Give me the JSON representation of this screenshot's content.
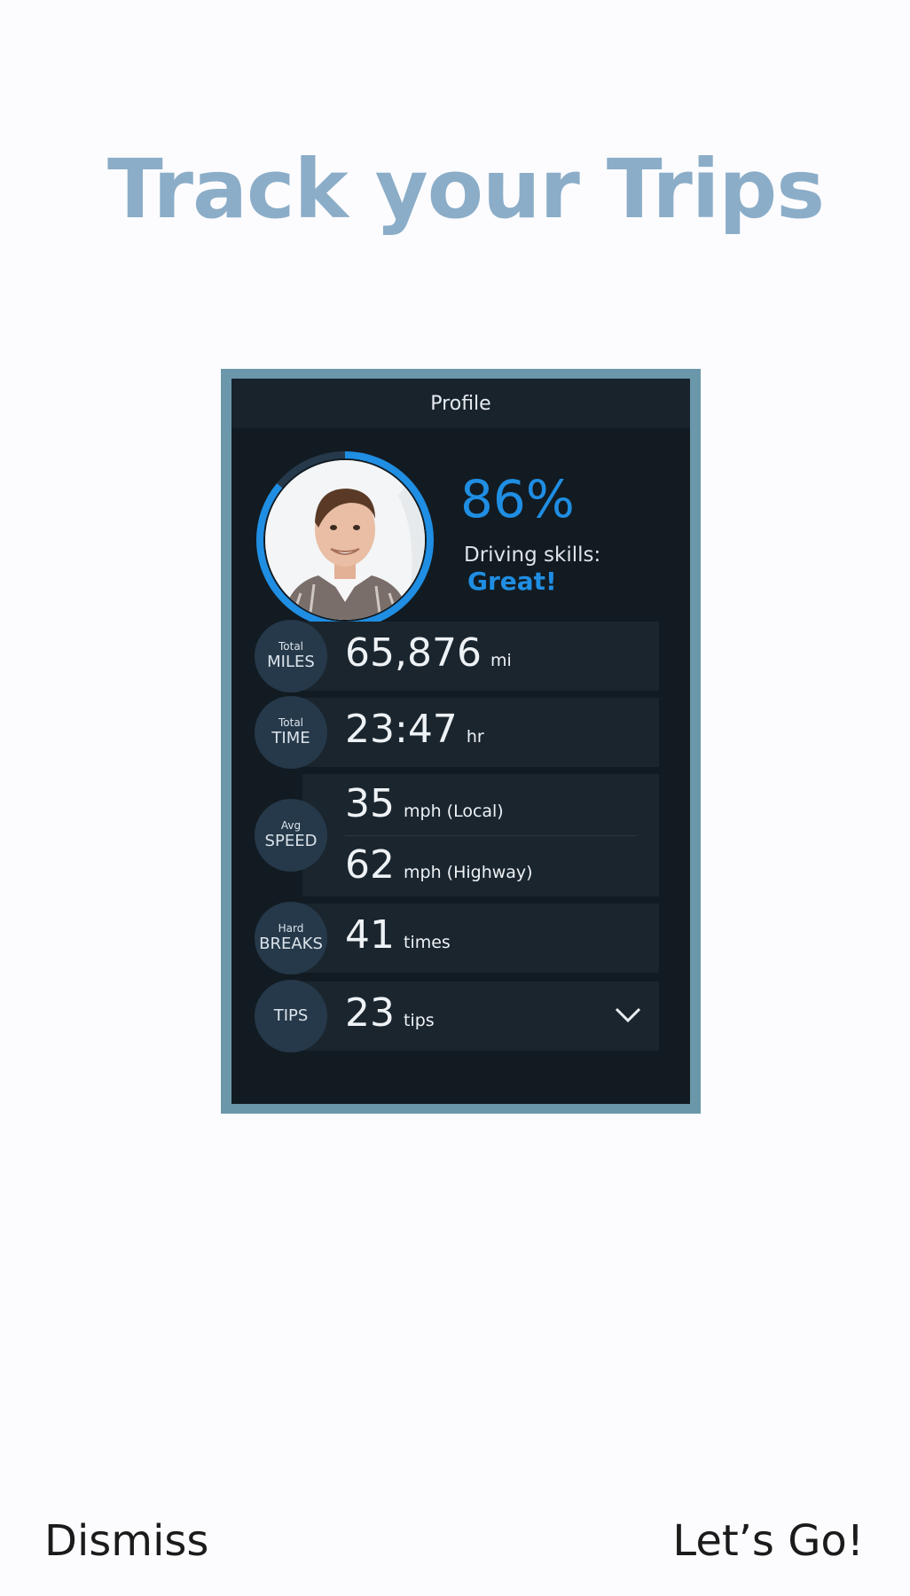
{
  "headline": "Track your Trips",
  "profile": {
    "header": "Profile",
    "score": "86%",
    "skill_label": "Driving skills:",
    "skill_value": "Great!",
    "score_fraction": 0.86,
    "stats": [
      {
        "small": "Total",
        "big": "MILES",
        "value": "65,876",
        "unit": "mi"
      },
      {
        "small": "Total",
        "big": "TIME",
        "value": "23:47",
        "unit": "hr"
      },
      {
        "small": "Avg",
        "big": "SPEED",
        "value": "35",
        "unit": "mph (Local)",
        "value2": "62",
        "unit2": "mph (Highway)"
      },
      {
        "small": "Hard",
        "big": "BREAKS",
        "value": "41",
        "unit": "times"
      },
      {
        "small": "",
        "big": "TIPS",
        "value": "23",
        "unit": "tips"
      }
    ]
  },
  "footer": {
    "dismiss_label": "Dismiss",
    "go_label": "Let’s Go!"
  },
  "colors": {
    "accent": "#1f8ee3",
    "headline": "#8badc8",
    "frame": "#6b97aa",
    "panel_bg": "#121b22"
  },
  "icons": {
    "expand": "chevron-down-icon",
    "avatar": "user-avatar-photo"
  }
}
